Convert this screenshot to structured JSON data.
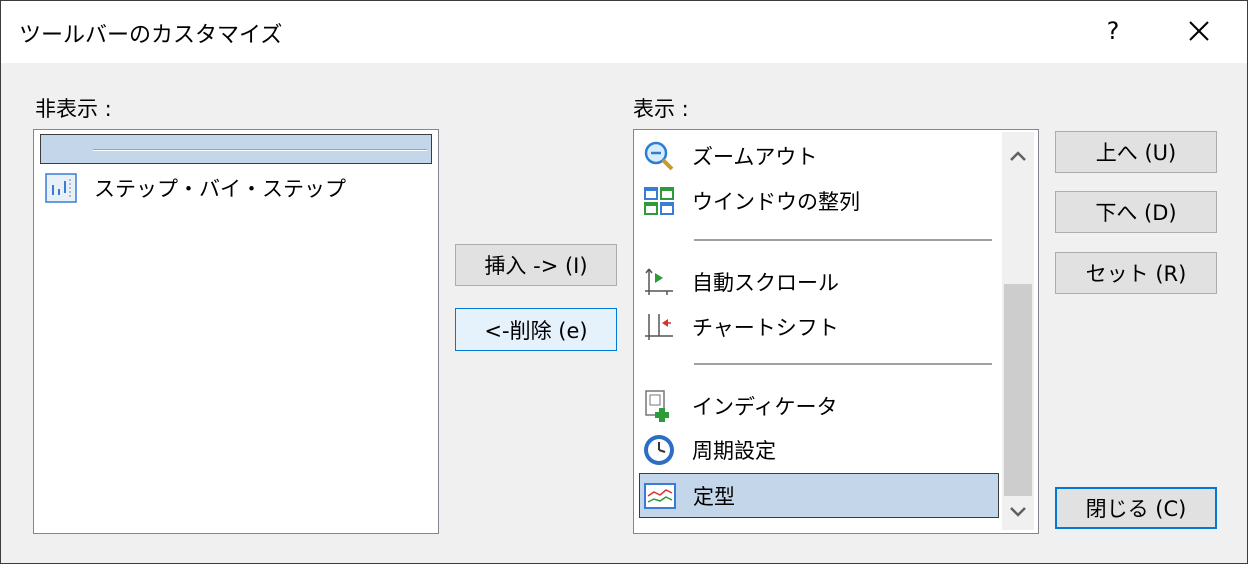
{
  "title": "ツールバーのカスタマイズ",
  "title_help": "?",
  "hidden_label": "非表示 :",
  "shown_label": "表示 :",
  "hidden_items": [
    {
      "label": "",
      "icon": "separator"
    },
    {
      "label": "ステップ・バイ・ステップ",
      "icon": "step-by-step-icon"
    }
  ],
  "shown_items": [
    {
      "label": "ズームアウト",
      "icon": "zoom-out-icon"
    },
    {
      "label": "ウインドウの整列",
      "icon": "tile-windows-icon"
    },
    {
      "label": "",
      "icon": "separator"
    },
    {
      "label": "自動スクロール",
      "icon": "auto-scroll-icon"
    },
    {
      "label": "チャートシフト",
      "icon": "chart-shift-icon"
    },
    {
      "label": "",
      "icon": "separator"
    },
    {
      "label": "インディケータ",
      "icon": "indicator-add-icon"
    },
    {
      "label": "周期設定",
      "icon": "clock-icon"
    },
    {
      "label": "定型",
      "icon": "template-icon"
    }
  ],
  "buttons": {
    "insert": "挿入 -> (I)",
    "delete": "<-削除 (e)",
    "up": "上へ (U)",
    "down": "下へ (D)",
    "reset": "セット (R)",
    "close": "閉じる (C)"
  },
  "colors": {
    "selection": "#c4d7ea",
    "accent": "#0078d7"
  }
}
